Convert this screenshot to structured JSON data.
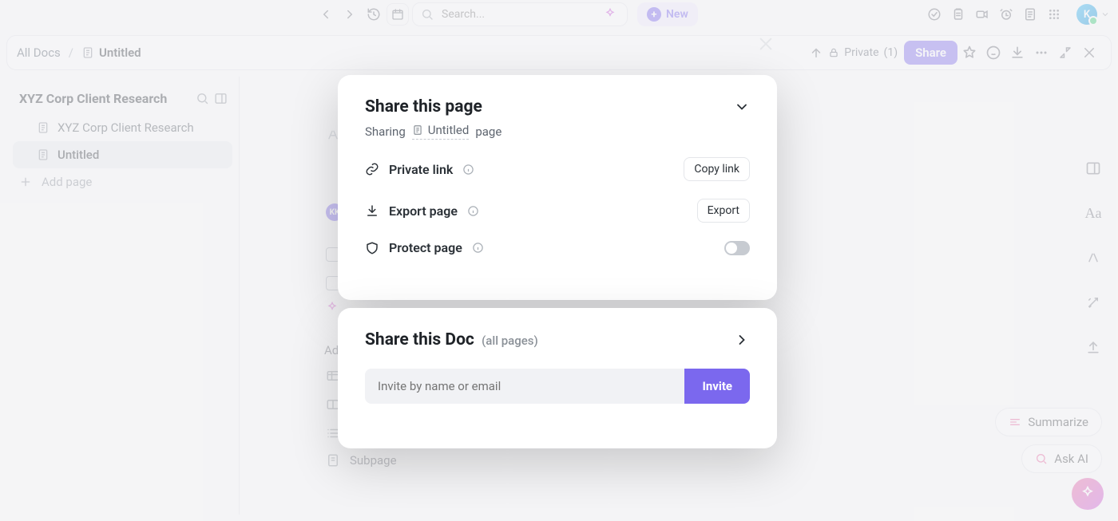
{
  "topbar": {
    "search_placeholder": "Search...",
    "new_label": "New"
  },
  "docbar": {
    "root": "All Docs",
    "current": "Untitled",
    "privacy_label": "Private",
    "privacy_count": "(1)",
    "share_label": "Share"
  },
  "sidebar": {
    "workspace_title": "XYZ Corp Client Research",
    "items": [
      {
        "label": "XYZ Corp Client Research"
      },
      {
        "label": "Untitled"
      }
    ],
    "add_page_label": "Add page"
  },
  "editor": {
    "add_new_label": "Ad",
    "subpage_label": "Subpage",
    "avatar_initials": "KK"
  },
  "rail": {},
  "chips": {
    "summarize": "Summarize",
    "ask": "Ask AI"
  },
  "modal": {
    "page": {
      "title": "Share this page",
      "sharing_prefix": "Sharing",
      "doc_name": "Untitled",
      "sharing_suffix": "page",
      "private_link_label": "Private link",
      "copy_link_label": "Copy link",
      "export_label": "Export page",
      "export_btn": "Export",
      "protect_label": "Protect page"
    },
    "doc": {
      "title": "Share this Doc",
      "subtitle": "(all pages)",
      "invite_placeholder": "Invite by name or email",
      "invite_label": "Invite"
    }
  },
  "avatar_letter": "K"
}
